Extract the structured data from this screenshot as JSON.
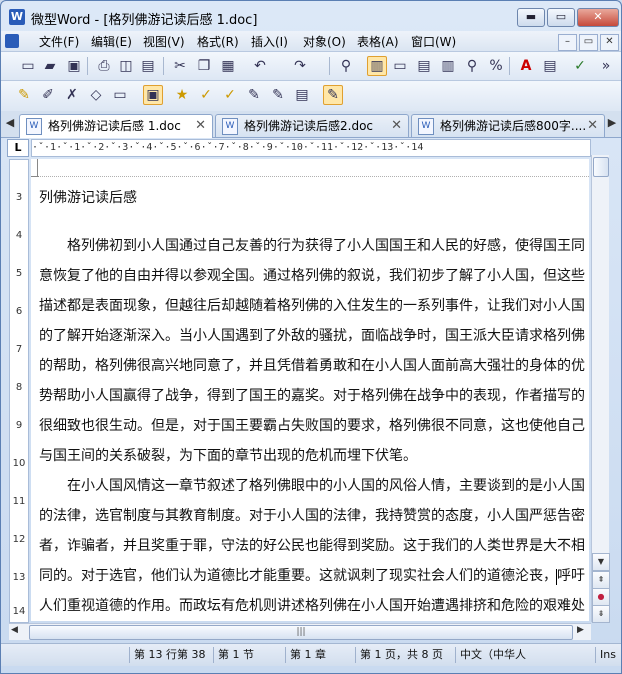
{
  "window": {
    "app_icon": "W",
    "title": "微型Word - [格列佛游记读后感 1.doc]"
  },
  "caption_buttons": {
    "minimize": "▬",
    "maximize": "▭",
    "close": "✕"
  },
  "menubar": {
    "items": [
      "文件(F)",
      "编辑(E)",
      "视图(V)",
      "格式(R)",
      "插入(I)",
      "对象(O)",
      "表格(A)",
      "窗口(W)"
    ],
    "mdi_buttons": [
      "–",
      "▭",
      "✕"
    ]
  },
  "toolbar1": {
    "icons": [
      "new-document-icon",
      "open-folder-icon",
      "save-icon",
      "print-icon",
      "print-preview-icon",
      "export-pdf-icon",
      "cut-icon",
      "copy-icon",
      "paste-icon",
      "undo-icon",
      "redo-icon",
      "find-icon",
      "layout-view-icon",
      "page-view-icon",
      "outline-view-icon",
      "draft-view-icon",
      "zoom-icon",
      "percent-icon",
      "font-color-icon",
      "format-icon",
      "spell-check-icon"
    ],
    "more": "»"
  },
  "toolbar2": {
    "icons": [
      "highlight-icon",
      "edit-icon",
      "delete-icon",
      "shape-icon",
      "text-icon",
      "clipboard-icon",
      "star-icon",
      "pin-icon",
      "tag-icon",
      "bookmark-icon",
      "link-icon",
      "note-icon",
      "comment-icon"
    ]
  },
  "doc_tabs": [
    {
      "label": "格列佛游记读后感 1.doc",
      "close": "✕",
      "active": true
    },
    {
      "label": "格列佛游记读后感2.doc",
      "close": "✕",
      "active": false
    },
    {
      "label": "格列佛游记读后感800字....",
      "close": "✕",
      "active": false
    }
  ],
  "tab_nav": {
    "prev": "◀",
    "next": "▶"
  },
  "ruler": {
    "corner": "L",
    "text": "·ˇ·1·ˇ·1·ˇ·2·ˇ·3·ˇ·4·ˇ·5·ˇ·6·ˇ·7·ˇ·8·ˇ·9·ˇ·10·ˇ·11·ˇ·12·ˇ·13·ˇ·14",
    "vertical_numbers": [
      "3",
      "4",
      "5",
      "6",
      "7",
      "8",
      "9",
      "10",
      "11",
      "12",
      "13",
      "14"
    ]
  },
  "document": {
    "heading": "列佛游记读后感",
    "lines": [
      "　　格列佛初到小人国通过自己友善的行为获得了小人国国王和人民的好感，使得国王同",
      "意恢复了他的自由并得以参观全国。通过格列佛的叙说，我们初步了解了小人国，但这些",
      "描述都是表面现象，但越往后却越随着格列佛的入住发生的一系列事件，让我们对小人国",
      "的了解开始逐渐深入。当小人国遇到了外敌的骚扰，面临战争时，国王派大臣请求格列佛",
      "的帮助，格列佛很高兴地同意了，并且凭借着勇敢和在小人国人面前高大强壮的身体的优",
      "势帮助小人国赢得了战争，得到了国王的嘉奖。对于格列佛在战争中的表现，作者描写的",
      "很细致也很生动。但是，对于国王要霸占失败国的要求，格列佛很不同意，这也使他自己",
      "与国王间的关系破裂，为下面的章节出现的危机而埋下伏笔。",
      "　　在小人国风情这一章节叙述了格列佛眼中的小人国的风俗人情，主要谈到的是小人国",
      "的法律，选官制度与其教育制度。对于小人国的法律，我持赞赏的态度，小人国严惩告密",
      "者，诈骗者，并且奖重于罪，守法的好公民也能得到奖励。这于我们的人类世界是大不相",
      "同的。对于选官，他们认为道德比才能重要。这就讽刺了现实社会人们的道德沦丧，呼吁",
      "人们重视道德的作用。而政坛有危机则讲述格列佛在小人国开始遭遇排挤和危险的艰难处"
    ]
  },
  "scrollbars": {
    "up": "▲",
    "down": "▼",
    "prev_page": "⇞",
    "browse": "●",
    "next_page": "⇟",
    "left": "◀",
    "right": "▶",
    "grip": "|||"
  },
  "statusbar": {
    "cells": [
      "第 13 行第 38",
      "第 1 节",
      "第 1 章",
      "第 1 页，共 8 页",
      "中文（中华人",
      "Ins"
    ]
  }
}
